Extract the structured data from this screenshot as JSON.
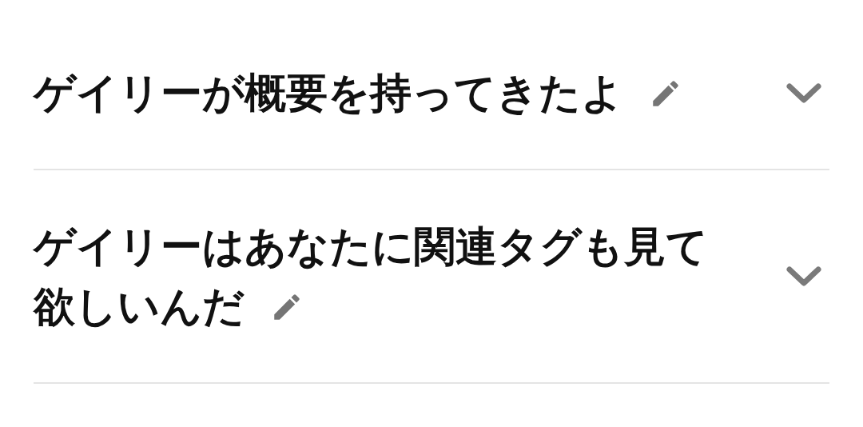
{
  "items": [
    {
      "title_lines": [
        "ゲイリーが概要を持ってきたよ"
      ],
      "expanded": false
    },
    {
      "title_lines": [
        "ゲイリーはあなたに関連タグも見て",
        "欲しいんだ"
      ],
      "expanded": false
    }
  ]
}
